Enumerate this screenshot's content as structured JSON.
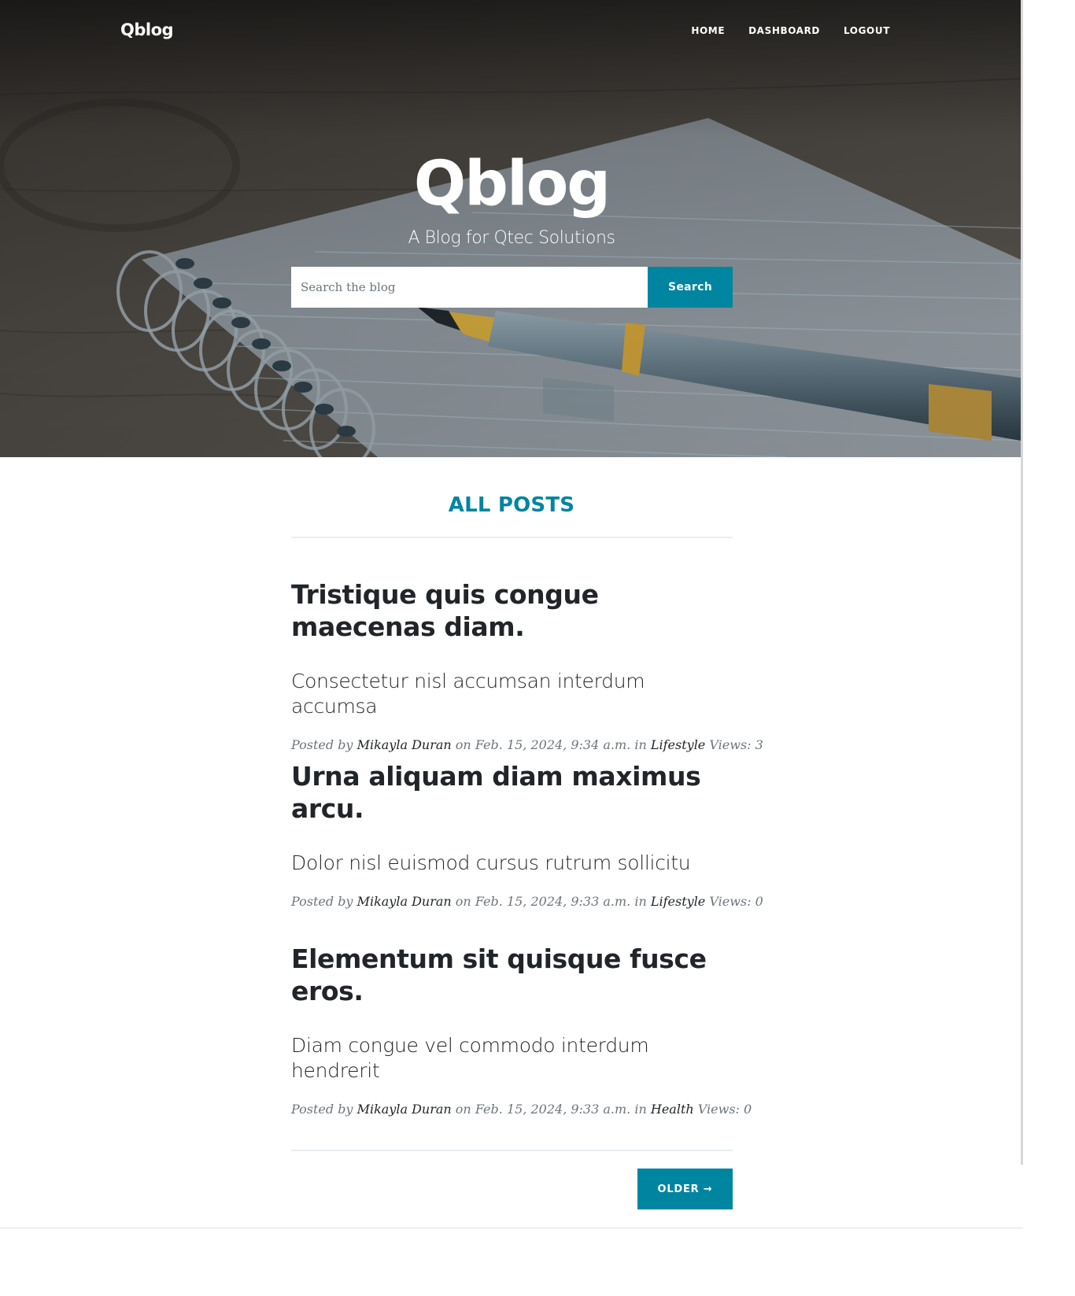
{
  "brand": "Qblog",
  "nav": {
    "home": "HOME",
    "dashboard": "DASHBOARD",
    "logout": "LOGOUT"
  },
  "hero": {
    "title": "Qblog",
    "subtitle": "A Blog for Qtec Solutions",
    "search_placeholder": "Search the blog",
    "search_button": "Search"
  },
  "section_heading": "ALL POSTS",
  "posts": [
    {
      "title": "Tristique quis congue maecenas diam.",
      "subtitle": "Consectetur nisl accumsan interdum accumsa",
      "posted_by_label": "Posted by",
      "author": "Mikayla Duran",
      "on_label": "on",
      "date": "Feb. 15, 2024, 9:34 a.m.",
      "in_label": "in",
      "category": "Lifestyle",
      "views_label": "Views:",
      "views": "3"
    },
    {
      "title": "Urna aliquam diam maximus arcu.",
      "subtitle": "Dolor nisl euismod cursus rutrum sollicitu",
      "posted_by_label": "Posted by",
      "author": "Mikayla Duran",
      "on_label": "on",
      "date": "Feb. 15, 2024, 9:33 a.m.",
      "in_label": "in",
      "category": "Lifestyle",
      "views_label": "Views:",
      "views": "0"
    },
    {
      "title": "Elementum sit quisque fusce eros.",
      "subtitle": "Diam congue vel commodo interdum hendrerit",
      "posted_by_label": "Posted by",
      "author": "Mikayla Duran",
      "on_label": "on",
      "date": "Feb. 15, 2024, 9:33 a.m.",
      "in_label": "in",
      "category": "Health",
      "views_label": "Views:",
      "views": "0"
    }
  ],
  "pager": {
    "older": "OLDER →"
  },
  "colors": {
    "accent": "#0085a1",
    "text": "#212529",
    "muted": "#6c757d"
  }
}
